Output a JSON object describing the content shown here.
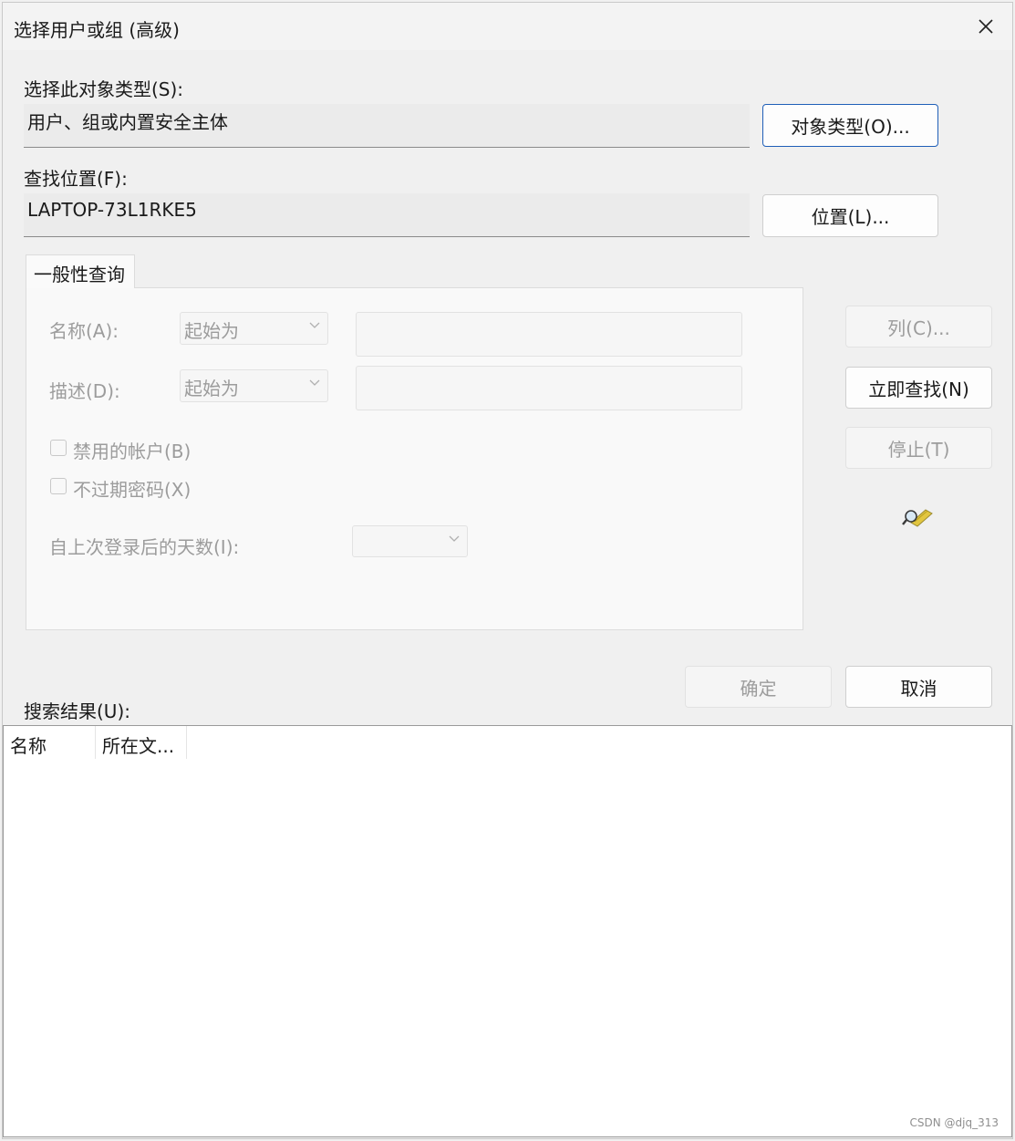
{
  "window": {
    "title": "选择用户或组 (高级)"
  },
  "object_type": {
    "label": "选择此对象类型(S):",
    "value": "用户、组或内置安全主体",
    "button": "对象类型(O)..."
  },
  "location": {
    "label": "查找位置(F):",
    "value": "LAPTOP-73L1RKE5",
    "button": "位置(L)..."
  },
  "query": {
    "tab": "一般性查询",
    "name_label": "名称(A):",
    "name_mode": "起始为",
    "desc_label": "描述(D):",
    "desc_mode": "起始为",
    "disabled_accounts": "禁用的帐户(B)",
    "non_expiring_pw": "不过期密码(X)",
    "days_since_login": "自上次登录后的天数(I):"
  },
  "side_buttons": {
    "columns": "列(C)...",
    "find_now": "立即查找(N)",
    "stop": "停止(T)"
  },
  "dialog_buttons": {
    "ok": "确定",
    "cancel": "取消"
  },
  "results": {
    "label": "搜索结果(U):",
    "columns": [
      "名称",
      "所在文..."
    ]
  },
  "watermark": "CSDN @djq_313",
  "colors": {
    "accent_border": "#1f5fb8",
    "disabled_text": "#9c9c9c"
  }
}
